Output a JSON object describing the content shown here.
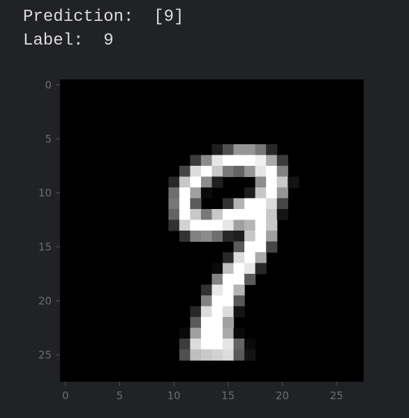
{
  "stdout": {
    "prediction_label": "Prediction:",
    "prediction_value": "[9]",
    "label_label": "Label:",
    "label_value": "9"
  },
  "chart_data": {
    "type": "heatmap",
    "title": "",
    "xlabel": "",
    "ylabel": "",
    "colormap": "gray",
    "xlim": [
      -0.5,
      27.5
    ],
    "ylim": [
      27.5,
      -0.5
    ],
    "x_ticks": [
      0,
      5,
      10,
      15,
      20,
      25
    ],
    "y_ticks": [
      0,
      5,
      10,
      15,
      20,
      25
    ],
    "grid": false,
    "colors": {
      "background": "#212225",
      "tick_color": "#6e6e6e",
      "axis_color": "#555555"
    },
    "image_size": [
      28,
      28
    ],
    "rows_start": 6,
    "pixels": [
      [
        0,
        0,
        0,
        0,
        0,
        0,
        0,
        0,
        0,
        0,
        0,
        0,
        0,
        0,
        30,
        80,
        150,
        150,
        120,
        40,
        0,
        0,
        0,
        0,
        0,
        0,
        0,
        0
      ],
      [
        0,
        0,
        0,
        0,
        0,
        0,
        0,
        0,
        0,
        0,
        0,
        0,
        60,
        140,
        230,
        255,
        255,
        255,
        240,
        170,
        60,
        0,
        0,
        0,
        0,
        0,
        0,
        0
      ],
      [
        0,
        0,
        0,
        0,
        0,
        0,
        0,
        0,
        0,
        0,
        0,
        70,
        220,
        255,
        200,
        120,
        100,
        150,
        230,
        255,
        130,
        0,
        0,
        0,
        0,
        0,
        0,
        0
      ],
      [
        0,
        0,
        0,
        0,
        0,
        0,
        0,
        0,
        0,
        0,
        40,
        200,
        255,
        140,
        30,
        0,
        0,
        0,
        140,
        255,
        200,
        20,
        0,
        0,
        0,
        0,
        0,
        0
      ],
      [
        0,
        0,
        0,
        0,
        0,
        0,
        0,
        0,
        0,
        0,
        110,
        255,
        160,
        10,
        0,
        0,
        0,
        30,
        200,
        255,
        150,
        0,
        0,
        0,
        0,
        0,
        0,
        0
      ],
      [
        0,
        0,
        0,
        0,
        0,
        0,
        0,
        0,
        0,
        0,
        120,
        255,
        90,
        0,
        0,
        50,
        180,
        255,
        255,
        220,
        70,
        0,
        0,
        0,
        0,
        0,
        0,
        0
      ],
      [
        0,
        0,
        0,
        0,
        0,
        0,
        0,
        0,
        0,
        0,
        100,
        255,
        200,
        120,
        200,
        255,
        255,
        255,
        255,
        200,
        20,
        0,
        0,
        0,
        0,
        0,
        0,
        0
      ],
      [
        0,
        0,
        0,
        0,
        0,
        0,
        0,
        0,
        0,
        0,
        50,
        210,
        255,
        255,
        255,
        230,
        160,
        180,
        255,
        200,
        0,
        0,
        0,
        0,
        0,
        0,
        0,
        0
      ],
      [
        0,
        0,
        0,
        0,
        0,
        0,
        0,
        0,
        0,
        0,
        0,
        50,
        130,
        140,
        110,
        40,
        30,
        200,
        255,
        160,
        0,
        0,
        0,
        0,
        0,
        0,
        0,
        0
      ],
      [
        0,
        0,
        0,
        0,
        0,
        0,
        0,
        0,
        0,
        0,
        0,
        0,
        0,
        0,
        0,
        0,
        90,
        255,
        255,
        70,
        0,
        0,
        0,
        0,
        0,
        0,
        0,
        0
      ],
      [
        0,
        0,
        0,
        0,
        0,
        0,
        0,
        0,
        0,
        0,
        0,
        0,
        0,
        0,
        0,
        40,
        220,
        255,
        170,
        0,
        0,
        0,
        0,
        0,
        0,
        0,
        0,
        0
      ],
      [
        0,
        0,
        0,
        0,
        0,
        0,
        0,
        0,
        0,
        0,
        0,
        0,
        0,
        0,
        10,
        190,
        255,
        230,
        40,
        0,
        0,
        0,
        0,
        0,
        0,
        0,
        0,
        0
      ],
      [
        0,
        0,
        0,
        0,
        0,
        0,
        0,
        0,
        0,
        0,
        0,
        0,
        0,
        0,
        130,
        255,
        255,
        90,
        0,
        0,
        0,
        0,
        0,
        0,
        0,
        0,
        0,
        0
      ],
      [
        0,
        0,
        0,
        0,
        0,
        0,
        0,
        0,
        0,
        0,
        0,
        0,
        0,
        50,
        230,
        255,
        180,
        0,
        0,
        0,
        0,
        0,
        0,
        0,
        0,
        0,
        0,
        0
      ],
      [
        0,
        0,
        0,
        0,
        0,
        0,
        0,
        0,
        0,
        0,
        0,
        0,
        0,
        130,
        255,
        255,
        90,
        0,
        0,
        0,
        0,
        0,
        0,
        0,
        0,
        0,
        0,
        0
      ],
      [
        0,
        0,
        0,
        0,
        0,
        0,
        0,
        0,
        0,
        0,
        0,
        0,
        40,
        220,
        255,
        220,
        20,
        0,
        0,
        0,
        0,
        0,
        0,
        0,
        0,
        0,
        0,
        0
      ],
      [
        0,
        0,
        0,
        0,
        0,
        0,
        0,
        0,
        0,
        0,
        0,
        0,
        90,
        255,
        255,
        160,
        0,
        0,
        0,
        0,
        0,
        0,
        0,
        0,
        0,
        0,
        0,
        0
      ],
      [
        0,
        0,
        0,
        0,
        0,
        0,
        0,
        0,
        0,
        0,
        0,
        10,
        160,
        255,
        255,
        170,
        10,
        0,
        0,
        0,
        0,
        0,
        0,
        0,
        0,
        0,
        0,
        0
      ],
      [
        0,
        0,
        0,
        0,
        0,
        0,
        0,
        0,
        0,
        0,
        0,
        60,
        220,
        255,
        255,
        230,
        100,
        10,
        0,
        0,
        0,
        0,
        0,
        0,
        0,
        0,
        0,
        0
      ],
      [
        0,
        0,
        0,
        0,
        0,
        0,
        0,
        0,
        0,
        0,
        0,
        80,
        190,
        200,
        210,
        220,
        90,
        20,
        0,
        0,
        0,
        0,
        0,
        0,
        0,
        0,
        0,
        0
      ]
    ]
  }
}
